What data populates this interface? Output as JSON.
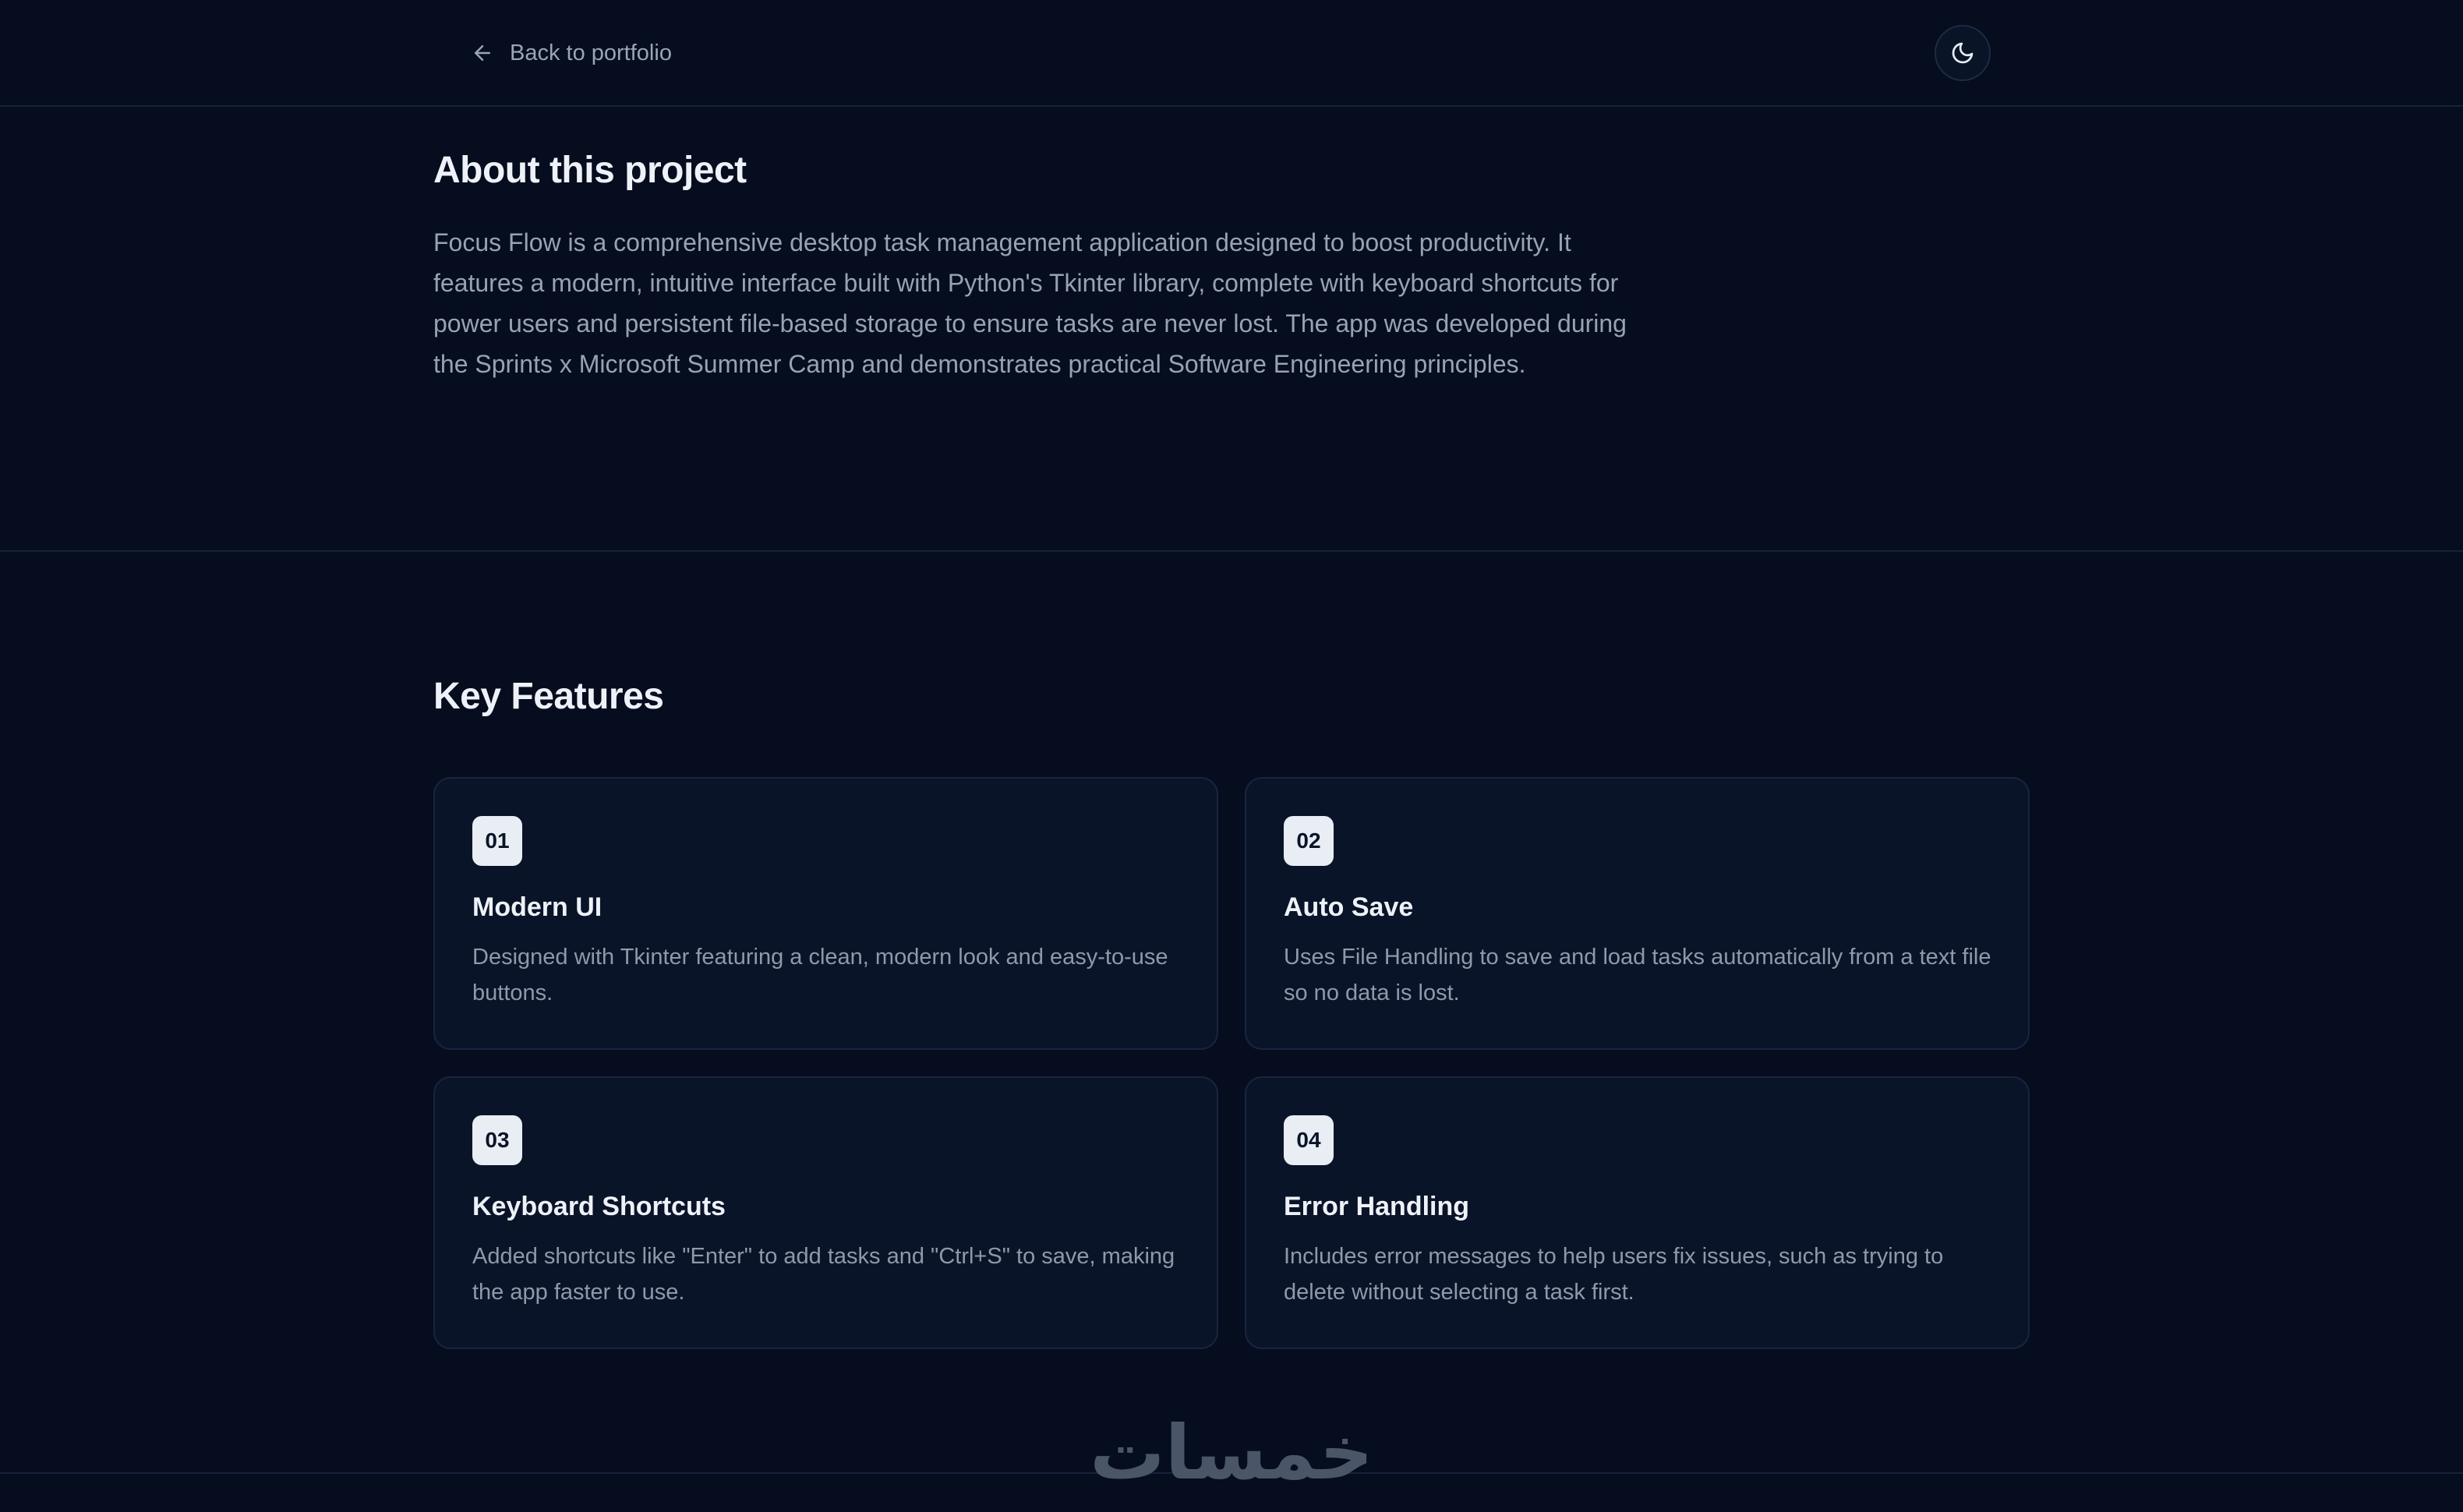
{
  "nav": {
    "back_label": "Back to portfolio",
    "back_icon": "arrow-left-icon",
    "theme_icon": "moon-icon"
  },
  "about": {
    "title": "About this project",
    "body": "Focus Flow is a comprehensive desktop task management application designed to boost productivity. It features a modern, intuitive interface built with Python's Tkinter library, complete with keyboard shortcuts for power users and persistent file-based storage to ensure tasks are never lost. The app was developed during the Sprints x Microsoft Summer Camp and demonstrates practical Software Engineering principles."
  },
  "features": {
    "title": "Key Features",
    "items": [
      {
        "number": "01",
        "title": "Modern UI",
        "description": "Designed with Tkinter featuring a clean, modern look and easy-to-use buttons."
      },
      {
        "number": "02",
        "title": "Auto Save",
        "description": "Uses File Handling to save and load tasks automatically from a text file so no data is lost."
      },
      {
        "number": "03",
        "title": "Keyboard Shortcuts",
        "description": "Added shortcuts like \"Enter\" to add tasks and \"Ctrl+S\" to save, making the app faster to use."
      },
      {
        "number": "04",
        "title": "Error Handling",
        "description": "Includes error messages to help users fix issues, such as trying to delete without selecting a task first."
      }
    ]
  },
  "footer": {
    "logo_text": "خمسات"
  },
  "colors": {
    "background": "#050d1e",
    "card_background": "#0a1428",
    "border": "#17213a",
    "heading": "#eef2f8",
    "body_text": "#98a2b4",
    "badge_background": "#e9edf4"
  }
}
